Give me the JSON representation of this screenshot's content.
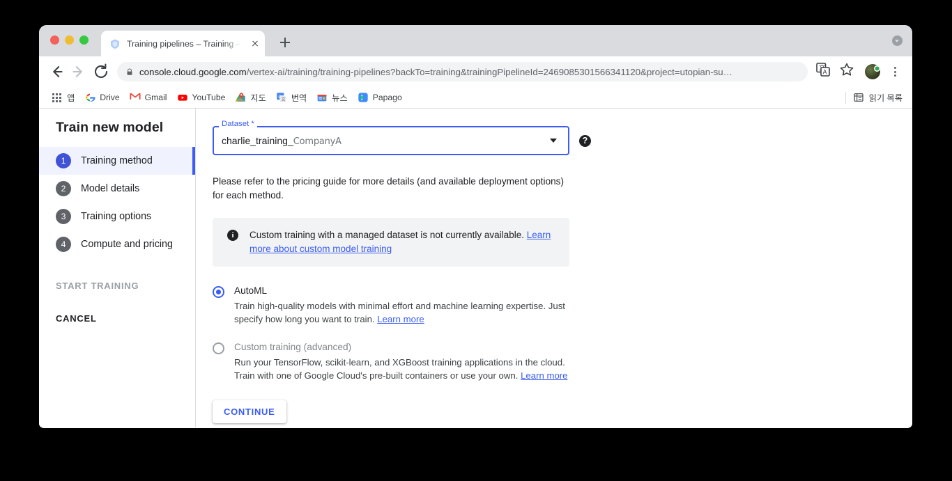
{
  "window": {
    "traffic_lights": [
      "close",
      "minimize",
      "maximize"
    ],
    "menu_icon": "window-menu-icon"
  },
  "browser": {
    "tab": {
      "title": "Training pipelines – Training – V",
      "favicon": "vertex-ai-favicon",
      "close_label": "close-tab"
    },
    "new_tab_label": "+",
    "nav": {
      "back": "back-icon",
      "forward": "forward-icon",
      "reload": "reload-icon"
    },
    "omnibox": {
      "lock": "lock-icon",
      "url_host": "console.cloud.google.com",
      "url_path": "/vertex-ai/training/training-pipelines?backTo=training&trainingPipelineId=2469085301566341120&project=utopian-su…"
    },
    "toolbar_right": {
      "translate": "translate-icon",
      "bookmark_star": "star-icon",
      "avatar": "user-avatar",
      "menu": "kebab-menu-icon"
    },
    "bookmarks": [
      {
        "label": "앱",
        "icon": "apps-grid-icon"
      },
      {
        "label": "Drive",
        "icon": "google-drive-icon"
      },
      {
        "label": "Gmail",
        "icon": "gmail-icon"
      },
      {
        "label": "YouTube",
        "icon": "youtube-icon"
      },
      {
        "label": "지도",
        "icon": "google-maps-icon"
      },
      {
        "label": "번역",
        "icon": "google-translate-icon"
      },
      {
        "label": "뉴스",
        "icon": "google-news-icon"
      },
      {
        "label": "Papago",
        "icon": "papago-icon"
      }
    ],
    "reading_list": {
      "label": "읽기 목록",
      "icon": "reading-list-icon"
    }
  },
  "sidebar": {
    "title": "Train new model",
    "steps": [
      {
        "num": "1",
        "label": "Training method",
        "active": true
      },
      {
        "num": "2",
        "label": "Model details",
        "active": false
      },
      {
        "num": "3",
        "label": "Training options",
        "active": false
      },
      {
        "num": "4",
        "label": "Compute and pricing",
        "active": false
      }
    ],
    "start_training_label": "START TRAINING",
    "cancel_label": "CANCEL"
  },
  "form": {
    "dataset_field": {
      "legend": "Dataset *",
      "value_prefix": "charlie_training_",
      "value_suffix": "CompanyA",
      "dropdown_icon": "chevron-down-icon",
      "help_icon_glyph": "?"
    },
    "pricing_note": "Please refer to the pricing guide for more details (and available deployment options) for each method.",
    "banner": {
      "icon_glyph": "i",
      "text": "Custom training with a managed dataset is not currently available.",
      "link": "Learn more about custom model training"
    },
    "options": [
      {
        "title": "AutoML",
        "description": "Train high-quality models with minimal effort and machine learning expertise. Just specify how long you want to train.",
        "link": "Learn more",
        "selected": true,
        "disabled": false
      },
      {
        "title": "Custom training (advanced)",
        "description": "Run your TensorFlow, scikit-learn, and XGBoost training applications in the cloud. Train with one of Google Cloud's pre-built containers or use your own.",
        "link": "Learn more",
        "selected": false,
        "disabled": true
      }
    ],
    "continue_label": "CONTINUE"
  },
  "colors": {
    "accent_blue": "#3b5cf5",
    "active_step_bg": "#f0f3fe",
    "banner_bg": "#f1f3f4",
    "text_primary": "#202124",
    "text_secondary": "#5f6368"
  }
}
